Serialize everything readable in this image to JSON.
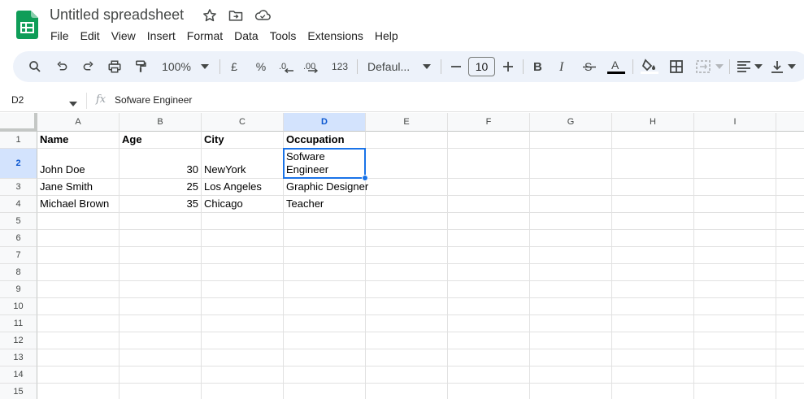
{
  "header": {
    "title": "Untitled spreadsheet",
    "menu": [
      "File",
      "Edit",
      "View",
      "Insert",
      "Format",
      "Data",
      "Tools",
      "Extensions",
      "Help"
    ]
  },
  "toolbar": {
    "zoom": "100%",
    "currency": "£",
    "percent": "%",
    "number_format": "123",
    "font": "Defaul...",
    "font_size": "10"
  },
  "formula_bar": {
    "cell_ref": "D2",
    "fx": "fx",
    "content": "Sofware Engineer"
  },
  "grid": {
    "columns": [
      "A",
      "B",
      "C",
      "D",
      "E",
      "F",
      "G",
      "H",
      "I"
    ],
    "rows": [
      "1",
      "2",
      "3",
      "4",
      "5",
      "6",
      "7",
      "8",
      "9",
      "10",
      "11",
      "12",
      "13",
      "14",
      "15"
    ],
    "selected_column": "D",
    "selected_row": "2",
    "cells": {
      "A1": "Name",
      "B1": "Age",
      "C1": "City",
      "D1": "Occupation",
      "A2": "John Doe",
      "B2": "30",
      "C2": "NewYork",
      "D2": "Sofware Engineer",
      "A3": "Jane Smith",
      "B3": "25",
      "C3": "Los Angeles",
      "D3": "Graphic Designer",
      "A4": "Michael Brown",
      "B4": "35",
      "C4": "Chicago",
      "D4": "Teacher"
    }
  },
  "colors": {
    "accent": "#1a73e8",
    "toolbar_bg": "#edf2fa",
    "header_selected": "#d3e3fd",
    "sheets_green": "#0f9d58"
  }
}
